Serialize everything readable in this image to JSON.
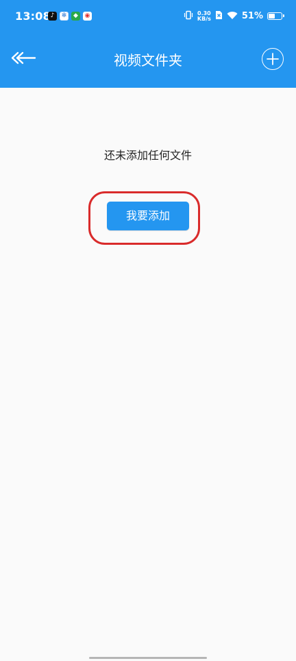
{
  "status_bar": {
    "time": "13:08",
    "net_speed_value": "0.30",
    "net_speed_unit": "KB/s",
    "battery": "51%",
    "battery_level_fraction": 0.51,
    "notification_icons": [
      "tiktok-icon",
      "weather-icon",
      "store-icon",
      "weibo-icon"
    ]
  },
  "header": {
    "title": "视频文件夹",
    "back_icon": "back-arrow-icon",
    "add_icon": "plus-circle-icon",
    "background_color": "#2496f0"
  },
  "empty_state": {
    "message": "还未添加任何文件",
    "button_label": "我要添加",
    "highlight_color": "#d92b2b"
  }
}
